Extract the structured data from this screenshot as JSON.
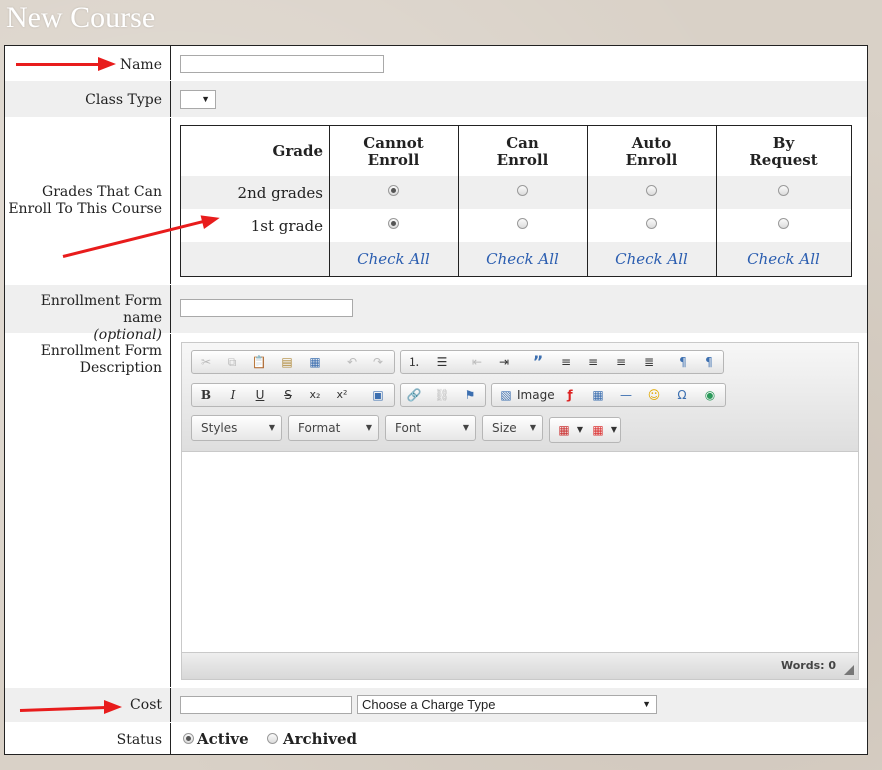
{
  "page": {
    "title": "New Course"
  },
  "form": {
    "name": {
      "label": "Name",
      "value": ""
    },
    "class_type": {
      "label": "Class Type",
      "value": ""
    },
    "grades": {
      "label_line1": "Grades That Can",
      "label_line2": "Enroll To This Course",
      "header_grade": "Grade",
      "columns": [
        {
          "line1": "Cannot",
          "line2": "Enroll"
        },
        {
          "line1": "Can",
          "line2": "Enroll"
        },
        {
          "line1": "Auto",
          "line2": "Enroll"
        },
        {
          "line1": "By",
          "line2": "Request"
        }
      ],
      "rows": [
        {
          "grade": "2nd grades",
          "selected": "Cannot Enroll"
        },
        {
          "grade": "1st grade",
          "selected": "Cannot Enroll"
        }
      ],
      "check_all": "Check All"
    },
    "enrollment_form_name": {
      "label_line1": "Enrollment Form",
      "label_line2": "name",
      "label_optional": "(optional)",
      "value": ""
    },
    "enrollment_form_description": {
      "label_line1": "Enrollment Form",
      "label_line2": "Description",
      "toolbar": {
        "image_label": "Image",
        "styles": "Styles",
        "format": "Format",
        "font": "Font",
        "size": "Size"
      },
      "words_count": "Words: 0"
    },
    "cost": {
      "label": "Cost",
      "value": "",
      "charge_type_placeholder": "Choose a Charge Type"
    },
    "status": {
      "label": "Status",
      "options": [
        "Active",
        "Archived"
      ],
      "selected": "Active"
    }
  },
  "colors": {
    "annotation_arrow": "#e81c1c",
    "link": "#2a5db0"
  }
}
